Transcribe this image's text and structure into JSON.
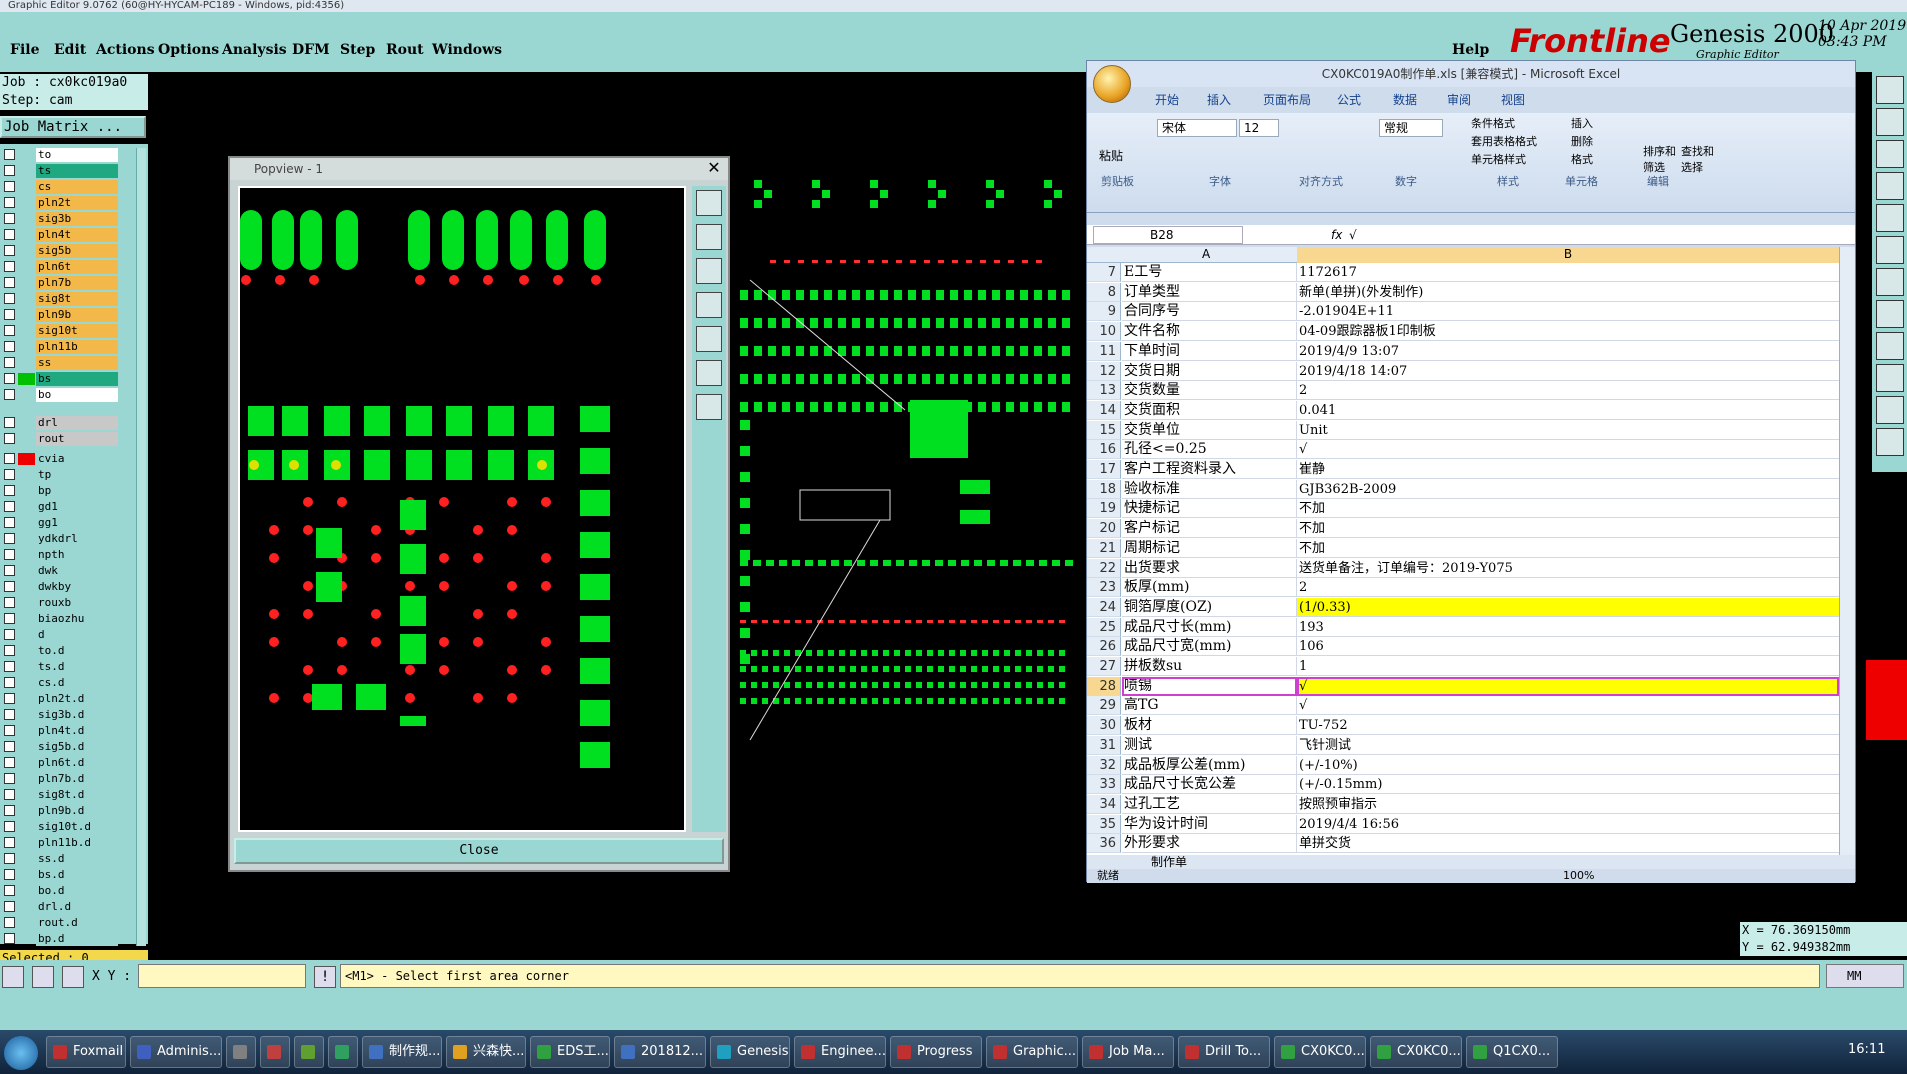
{
  "window_title": "Graphic Editor 9.0762 (60@HY-HYCAM-PC189 - Windows, pid:4356)",
  "menu": [
    "File",
    "Edit",
    "Actions",
    "Options",
    "Analysis",
    "DFM",
    "Step",
    "Rout",
    "Windows"
  ],
  "help": "Help",
  "brand": {
    "name": "Frontline",
    "product": "Genesis 2000",
    "subtitle": "Graphic Editor",
    "date": "10 Apr 2019",
    "time": "03:43 PM"
  },
  "job": {
    "job_line": "Job : cx0kc019a0",
    "step_line": "Step: cam",
    "matrix_button": "Job Matrix ..."
  },
  "layers": [
    {
      "name": "to",
      "color": "#ffffff"
    },
    {
      "name": "ts",
      "color": "#20a880"
    },
    {
      "name": "cs",
      "color": "#f2b84a"
    },
    {
      "name": "pln2t",
      "color": "#f2b84a"
    },
    {
      "name": "sig3b",
      "color": "#f2b84a"
    },
    {
      "name": "pln4t",
      "color": "#f2b84a"
    },
    {
      "name": "sig5b",
      "color": "#f2b84a"
    },
    {
      "name": "pln6t",
      "color": "#f2b84a"
    },
    {
      "name": "pln7b",
      "color": "#f2b84a"
    },
    {
      "name": "sig8t",
      "color": "#f2b84a"
    },
    {
      "name": "pln9b",
      "color": "#f2b84a"
    },
    {
      "name": "sig10t",
      "color": "#f2b84a"
    },
    {
      "name": "pln11b",
      "color": "#f2b84a"
    },
    {
      "name": "ss",
      "color": "#f2b84a"
    },
    {
      "name": "bs",
      "color": "#20a880"
    },
    {
      "name": "bo",
      "color": "#ffffff"
    },
    {
      "name": "drl",
      "color": "#c8c8c8"
    },
    {
      "name": "rout",
      "color": "#c8c8c8"
    },
    {
      "name": "cvia",
      "color": "#9ad6d2"
    },
    {
      "name": "tp",
      "color": "#9ad6d2"
    },
    {
      "name": "bp",
      "color": "#9ad6d2"
    },
    {
      "name": "gd1",
      "color": "#9ad6d2"
    },
    {
      "name": "gg1",
      "color": "#9ad6d2"
    },
    {
      "name": "ydkdrl",
      "color": "#9ad6d2"
    },
    {
      "name": "npth",
      "color": "#9ad6d2"
    },
    {
      "name": "dwk",
      "color": "#9ad6d2"
    },
    {
      "name": "dwkby",
      "color": "#9ad6d2"
    },
    {
      "name": "rouxb",
      "color": "#9ad6d2"
    },
    {
      "name": "biaozhu",
      "color": "#9ad6d2"
    },
    {
      "name": "d",
      "color": "#9ad6d2"
    },
    {
      "name": "to.d",
      "color": "#9ad6d2"
    },
    {
      "name": "ts.d",
      "color": "#9ad6d2"
    },
    {
      "name": "cs.d",
      "color": "#9ad6d2"
    },
    {
      "name": "pln2t.d",
      "color": "#9ad6d2"
    },
    {
      "name": "sig3b.d",
      "color": "#9ad6d2"
    },
    {
      "name": "pln4t.d",
      "color": "#9ad6d2"
    },
    {
      "name": "sig5b.d",
      "color": "#9ad6d2"
    },
    {
      "name": "pln6t.d",
      "color": "#9ad6d2"
    },
    {
      "name": "pln7b.d",
      "color": "#9ad6d2"
    },
    {
      "name": "sig8t.d",
      "color": "#9ad6d2"
    },
    {
      "name": "pln9b.d",
      "color": "#9ad6d2"
    },
    {
      "name": "sig10t.d",
      "color": "#9ad6d2"
    },
    {
      "name": "pln11b.d",
      "color": "#9ad6d2"
    },
    {
      "name": "ss.d",
      "color": "#9ad6d2"
    },
    {
      "name": "bs.d",
      "color": "#9ad6d2"
    },
    {
      "name": "bo.d",
      "color": "#9ad6d2"
    },
    {
      "name": "drl.d",
      "color": "#9ad6d2"
    },
    {
      "name": "rout.d",
      "color": "#9ad6d2"
    },
    {
      "name": "bp.d",
      "color": "#9ad6d2"
    }
  ],
  "selected": "Selected : 0",
  "popview": {
    "title": "Popview - 1",
    "close": "Close"
  },
  "excel": {
    "title": "CX0KC019A0制作单.xls [兼容模式] - Microsoft Excel",
    "tabs": [
      "开始",
      "插入",
      "页面布局",
      "公式",
      "数据",
      "审阅",
      "视图"
    ],
    "font_name": "宋体",
    "font_size": "12",
    "number_format": "常规",
    "group_labels": [
      "剪贴板",
      "字体",
      "对齐方式",
      "数字",
      "样式",
      "单元格",
      "编辑"
    ],
    "paste": "粘贴",
    "style_items": [
      "条件格式",
      "套用表格格式",
      "单元格样式"
    ],
    "cell_items": [
      "插入",
      "删除",
      "格式"
    ],
    "edit_items": [
      "排序和筛选",
      "查找和选择"
    ],
    "name_box": "B28",
    "formula_value": "√",
    "col_a": "A",
    "col_b": "B",
    "rows": [
      {
        "n": "7",
        "a": "E工号",
        "b": "1172617"
      },
      {
        "n": "8",
        "a": "订单类型",
        "b": "新单(单拼)(外发制作)"
      },
      {
        "n": "9",
        "a": "合同序号",
        "b": "-2.01904E+11"
      },
      {
        "n": "10",
        "a": "文件名称",
        "b": "04-09跟踪器板1印制板"
      },
      {
        "n": "11",
        "a": "下单时间",
        "b": "2019/4/9 13:07"
      },
      {
        "n": "12",
        "a": "交货日期",
        "b": "2019/4/18 14:07"
      },
      {
        "n": "13",
        "a": "交货数量",
        "b": "2"
      },
      {
        "n": "14",
        "a": "交货面积",
        "b": "0.041"
      },
      {
        "n": "15",
        "a": "交货单位",
        "b": "Unit"
      },
      {
        "n": "16",
        "a": "孔径<=0.25",
        "b": "√"
      },
      {
        "n": "17",
        "a": "客户工程资料录入",
        "b": "崔静"
      },
      {
        "n": "18",
        "a": "验收标准",
        "b": "GJB362B-2009"
      },
      {
        "n": "19",
        "a": "快捷标记",
        "b": "不加"
      },
      {
        "n": "20",
        "a": "客户标记",
        "b": "不加"
      },
      {
        "n": "21",
        "a": "周期标记",
        "b": "不加"
      },
      {
        "n": "22",
        "a": "出货要求",
        "b": "送货单备注，订单编号：2019-Y075"
      },
      {
        "n": "23",
        "a": "板厚(mm)",
        "b": "2"
      },
      {
        "n": "24",
        "a": "铜箔厚度(OZ)",
        "b": "(1/0.33)",
        "hl": true
      },
      {
        "n": "25",
        "a": "成品尺寸长(mm)",
        "b": "193"
      },
      {
        "n": "26",
        "a": "成品尺寸宽(mm)",
        "b": "106"
      },
      {
        "n": "27",
        "a": "拼板数su",
        "b": "1"
      },
      {
        "n": "28",
        "a": "喷锡",
        "b": "√",
        "hl": true,
        "sel": true
      },
      {
        "n": "29",
        "a": "高TG",
        "b": "√"
      },
      {
        "n": "30",
        "a": "板材",
        "b": "TU-752"
      },
      {
        "n": "31",
        "a": "测试",
        "b": "飞针测试"
      },
      {
        "n": "32",
        "a": "成品板厚公差(mm)",
        "b": "(+/-10%)"
      },
      {
        "n": "33",
        "a": "成品尺寸长宽公差",
        "b": "(+/-0.15mm)"
      },
      {
        "n": "34",
        "a": "过孔工艺",
        "b": "按照预审指示"
      },
      {
        "n": "35",
        "a": "华为设计时间",
        "b": "2019/4/4 16:56"
      },
      {
        "n": "36",
        "a": "外形要求",
        "b": "单拼交货"
      }
    ],
    "sheet_tab": "制作单",
    "status_left": "就绪",
    "zoom": "100%"
  },
  "coords": {
    "x": "X = 76.369150mm",
    "y": "Y = 62.949382mm"
  },
  "cmd": {
    "xy_label": "X Y :",
    "prompt": "<M1> - Select first area corner",
    "unit": "MM"
  },
  "taskbar": [
    {
      "label": "Foxmail",
      "color": "#c03030"
    },
    {
      "label": "Adminis...",
      "color": "#4060c0"
    },
    {
      "label": "",
      "color": "#808080"
    },
    {
      "label": "",
      "color": "#c04040"
    },
    {
      "label": "",
      "color": "#60a030"
    },
    {
      "label": "",
      "color": "#30a060"
    },
    {
      "label": "制作规...",
      "color": "#4070c0"
    },
    {
      "label": "兴森快...",
      "color": "#e0a020"
    },
    {
      "label": "EDS工...",
      "color": "#30a040"
    },
    {
      "label": "201812...",
      "color": "#4070c0"
    },
    {
      "label": "Genesis",
      "color": "#20a0c0"
    },
    {
      "label": "Enginee...",
      "color": "#c03030"
    },
    {
      "label": "Progress",
      "color": "#c03030"
    },
    {
      "label": "Graphic...",
      "color": "#c03030"
    },
    {
      "label": "Job Ma...",
      "color": "#c03030"
    },
    {
      "label": "Drill To...",
      "color": "#c03030"
    },
    {
      "label": "CX0KC0...",
      "color": "#30a040"
    },
    {
      "label": "CX0KC0...",
      "color": "#30a040"
    },
    {
      "label": "Q1CX0...",
      "color": "#30a040"
    }
  ],
  "clock": "16:11"
}
